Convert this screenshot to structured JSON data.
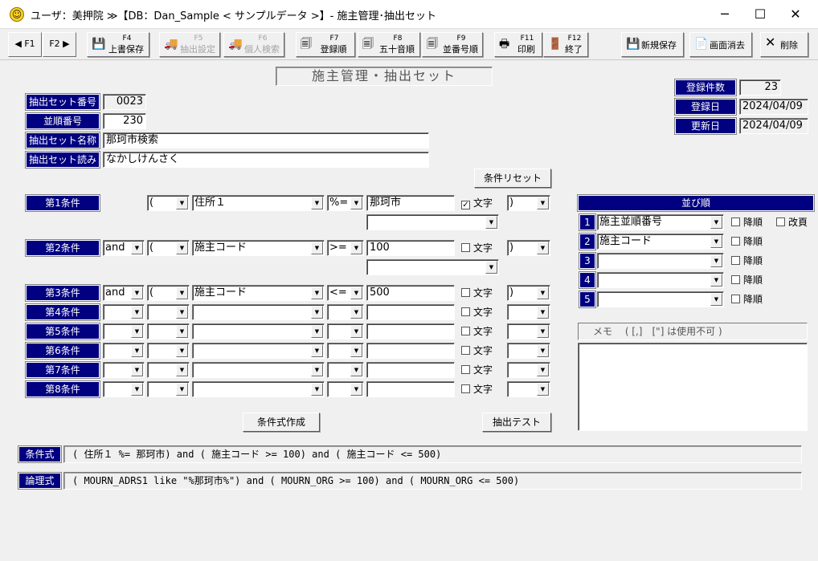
{
  "window": {
    "title": "ユーザ：美押院 ≫【DB：Dan_Sample < サンプルデータ >】- 施主管理･抽出セット",
    "minimize": "─",
    "maximize": "☐",
    "close": "✕"
  },
  "toolbar": {
    "f1": "F1",
    "f2": "F2",
    "buttons": [
      {
        "key": "F4",
        "label": "上書保存",
        "icon": "save-icon",
        "enabled": true
      },
      {
        "key": "F5",
        "label": "抽出設定",
        "icon": "truck-icon",
        "enabled": false
      },
      {
        "key": "F6",
        "label": "個人検索",
        "icon": "truck-icon",
        "enabled": false
      },
      {
        "key": "F7",
        "label": "登録順",
        "icon": "copy-icon",
        "enabled": true
      },
      {
        "key": "F8",
        "label": "五十音順",
        "icon": "copy-icon",
        "enabled": true
      },
      {
        "key": "F9",
        "label": "並番号順",
        "icon": "copy-icon",
        "enabled": true
      },
      {
        "key": "F11",
        "label": "印刷",
        "icon": "printer-icon",
        "enabled": true
      },
      {
        "key": "F12",
        "label": "終了",
        "icon": "exit-icon",
        "enabled": true
      }
    ],
    "new_save": "新規保存",
    "clear_screen": "画面消去",
    "delete": "削除"
  },
  "screen_title": "施主管理・抽出セット",
  "info": {
    "count_label": "登録件数",
    "count": "23",
    "reg_label": "登録日",
    "reg_date": "2024/04/09",
    "upd_label": "更新日",
    "upd_date": "2024/04/09"
  },
  "set": {
    "no_label": "抽出セット番号",
    "no": "0023",
    "order_label": "並順番号",
    "order": "230",
    "name_label": "抽出セット名称",
    "name": "那珂市検索",
    "reading_label": "抽出セット読み",
    "reading": "なかしけんさく"
  },
  "reset_button": "条件リセット",
  "conditions": [
    {
      "label": "第1条件",
      "conj": "",
      "open": "(",
      "field": "住所１",
      "op": "%=",
      "value": "那珂市",
      "text": true,
      "close": ")",
      "value2": ""
    },
    {
      "label": "第2条件",
      "conj": "and",
      "open": "(",
      "field": "施主コード",
      "op": ">=",
      "value": "100",
      "text": false,
      "close": ")",
      "value2": ""
    },
    {
      "label": "第3条件",
      "conj": "and",
      "open": "(",
      "field": "施主コード",
      "op": "<=",
      "value": "500",
      "text": false,
      "close": ")"
    },
    {
      "label": "第4条件",
      "conj": "",
      "open": "",
      "field": "",
      "op": "",
      "value": "",
      "text": false,
      "close": ""
    },
    {
      "label": "第5条件",
      "conj": "",
      "open": "",
      "field": "",
      "op": "",
      "value": "",
      "text": false,
      "close": ""
    },
    {
      "label": "第6条件",
      "conj": "",
      "open": "",
      "field": "",
      "op": "",
      "value": "",
      "text": false,
      "close": ""
    },
    {
      "label": "第7条件",
      "conj": "",
      "open": "",
      "field": "",
      "op": "",
      "value": "",
      "text": false,
      "close": ""
    },
    {
      "label": "第8条件",
      "conj": "",
      "open": "",
      "field": "",
      "op": "",
      "value": "",
      "text": false,
      "close": ""
    }
  ],
  "text_label": "文字",
  "sort": {
    "header": "並び順",
    "desc_label": "降順",
    "pagebreak_label": "改頁",
    "rows": [
      {
        "no": "1",
        "field": "施主並順番号"
      },
      {
        "no": "2",
        "field": "施主コード"
      },
      {
        "no": "3",
        "field": ""
      },
      {
        "no": "4",
        "field": ""
      },
      {
        "no": "5",
        "field": ""
      }
    ]
  },
  "memo": {
    "header": "メモ　 ( [,]　[\"] は使用不可 )",
    "value": ""
  },
  "build_button": "条件式作成",
  "test_button": "抽出テスト",
  "expr": {
    "cond_label": "条件式",
    "cond": "( 住所１ %= 那珂市) and ( 施主コード >= 100) and ( 施主コード <= 500)",
    "logic_label": "論理式",
    "logic": "( MOURN_ADRS1 like \"%那珂市%\") and ( MOURN_ORG >= 100) and ( MOURN_ORG <= 500)"
  }
}
